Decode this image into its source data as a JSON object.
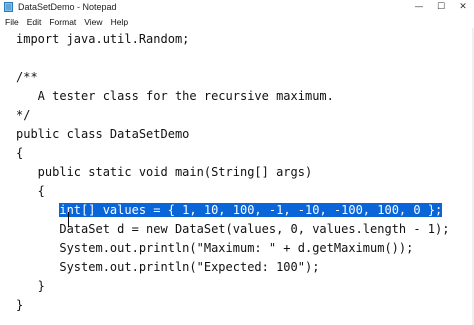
{
  "window": {
    "title": "DataSetDemo - Notepad",
    "minimize_icon": "minimize-icon",
    "maximize_icon": "maximize-icon",
    "close_icon": "close-icon"
  },
  "menu": [
    "File",
    "Edit",
    "Format",
    "View",
    "Help"
  ],
  "editor": {
    "lines": [
      "import java.util.Random;",
      "",
      "/**",
      "   A tester class for the recursive maximum.",
      "*/",
      "public class DataSetDemo",
      "{",
      "   public static void main(String[] args)",
      "   {",
      "      int[] values = { 1, 10, 100, -1, -10, -100, 100, 0 };",
      "      DataSet d = new DataSet(values, 0, values.length - 1);",
      "      System.out.println(\"Maximum: \" + d.getMaximum());",
      "      System.out.println(\"Expected: 100\");",
      "   }",
      "}"
    ],
    "selected_text": "int[] values = { 1, 10, 100, -1, -10, -100, 100, 0 };",
    "selection_color": "#0a66d8"
  }
}
